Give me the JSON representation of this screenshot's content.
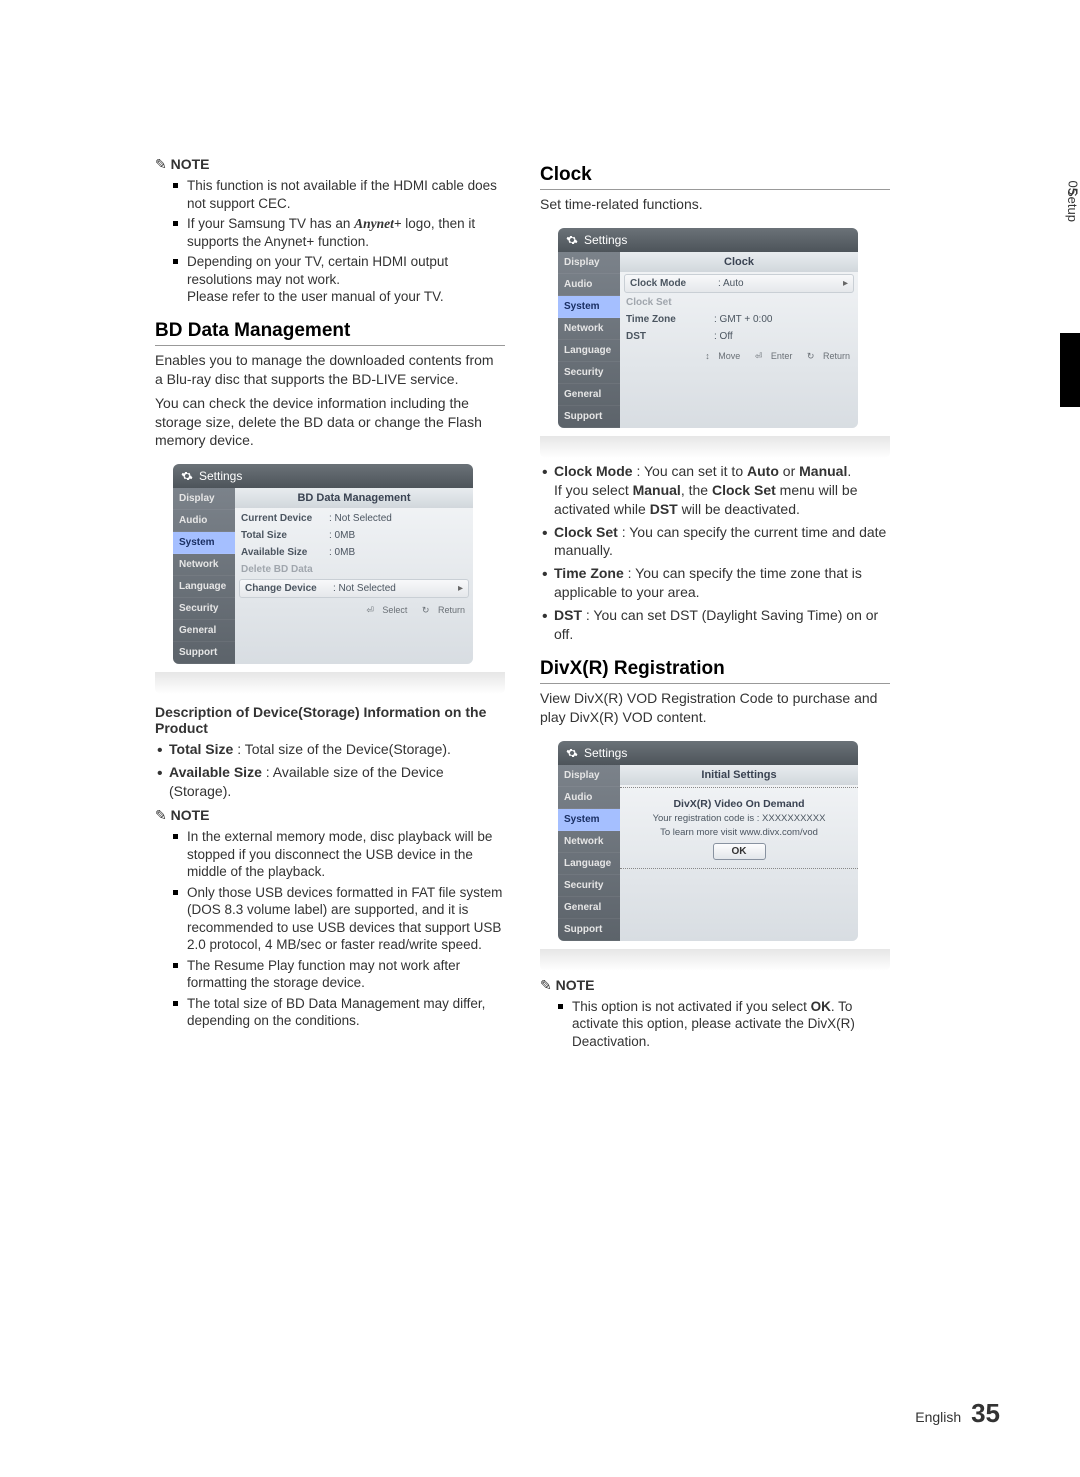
{
  "tab": {
    "num": "05",
    "label": "Setup"
  },
  "left": {
    "note1_heading": "NOTE",
    "note1_items": [
      "This function is not available if the HDMI cable does not support CEC.",
      "If your Samsung TV has an Anynet+ logo, then it supports the Anynet+ function.",
      "Depending on your TV, certain HDMI output resolutions may not work.\nPlease refer to the user manual of your TV."
    ],
    "bd_heading": "BD Data Management",
    "bd_p1": "Enables you to manage the downloaded contents from a Blu-ray disc that supports the BD-LIVE service.",
    "bd_p2": "You can check the device information including the storage size, delete the BD data or change the Flash memory device.",
    "panel1": {
      "header": "Settings",
      "nav": [
        "Display",
        "Audio",
        "System",
        "Network",
        "Language",
        "Security",
        "General",
        "Support"
      ],
      "nav_active_index": 2,
      "title": "BD Data Management",
      "rows": [
        {
          "label": "Current Device",
          "val": ": Not Selected",
          "type": "normal"
        },
        {
          "label": "Total Size",
          "val": ": 0MB",
          "type": "normal"
        },
        {
          "label": "Available Size",
          "val": ": 0MB",
          "type": "normal"
        },
        {
          "label": "Delete BD Data",
          "val": "",
          "type": "disabled"
        },
        {
          "label": "Change Device",
          "val": ": Not Selected",
          "type": "selectable"
        }
      ],
      "hints": {
        "select": "Select",
        "ret": "Return"
      }
    },
    "desc_heading": "Description of Device(Storage) Information on the Product",
    "desc_items": [
      {
        "bold": "Total Size",
        "rest": " : Total size of the Device(Storage)."
      },
      {
        "bold": "Available Size",
        "rest": " : Available size of the Device (Storage)."
      }
    ],
    "note2_heading": "NOTE",
    "note2_items": [
      "In the external memory mode, disc playback will be stopped if you disconnect the USB device in the middle of the playback.",
      "Only those USB devices formatted in FAT file system (DOS 8.3 volume label) are supported, and it is recommended to use USB devices that support USB 2.0 protocol, 4 MB/sec or faster read/write speed.",
      "The Resume Play function may not work after formatting the storage device.",
      "The total size of BD Data Management may differ, depending on the conditions."
    ]
  },
  "right": {
    "clock_heading": "Clock",
    "clock_intro": "Set time-related functions.",
    "panel2": {
      "header": "Settings",
      "nav": [
        "Display",
        "Audio",
        "System",
        "Network",
        "Language",
        "Security",
        "General",
        "Support"
      ],
      "nav_active_index": 2,
      "title": "Clock",
      "rows": [
        {
          "label": "Clock Mode",
          "val": ": Auto",
          "type": "selectable"
        },
        {
          "label": "Clock Set",
          "val": "",
          "type": "disabled"
        },
        {
          "label": "Time Zone",
          "val": ": GMT + 0:00",
          "type": "normal"
        },
        {
          "label": "DST",
          "val": ": Off",
          "type": "normal"
        }
      ],
      "hints": {
        "move": "Move",
        "enter": "Enter",
        "ret": "Return"
      }
    },
    "clock_items": [
      {
        "lead": "Clock Mode",
        "text": " : You can set it to ",
        "b2": "Auto",
        "mid": " or ",
        "b3": "Manual",
        "tail": ".",
        "extra": "If you select Manual, the Clock Set menu will be activated while DST will be deactivated.",
        "extra_bold": [
          "Manual",
          "Clock Set",
          "DST"
        ]
      },
      {
        "lead": "Clock Set",
        "text": " : You can specify the current time and date manually."
      },
      {
        "lead": "Time Zone",
        "text": " : You can specify the time zone that is applicable to your area."
      },
      {
        "lead": "DST",
        "text": " : You can set DST (Daylight Saving Time) on or off."
      }
    ],
    "divx_heading": "DivX(R) Registration",
    "divx_intro": "View DivX(R) VOD Registration Code to purchase and play DivX(R) VOD content.",
    "panel3": {
      "header": "Settings",
      "nav": [
        "Display",
        "Audio",
        "System",
        "Network",
        "Language",
        "Security",
        "General",
        "Support"
      ],
      "nav_active_index": 2,
      "title": "Initial Settings",
      "d_title": "DivX(R) Video On Demand",
      "d_line1": "Your registration code is : XXXXXXXXXX",
      "d_line2": "To learn more visit www.divx.com/vod",
      "ok": "OK"
    },
    "note3_heading": "NOTE",
    "note3_item_pre": "This option is not activated if you select ",
    "note3_item_bold": "OK",
    "note3_item_post": ". To activate this option, please activate the DivX(R) Deactivation."
  },
  "footer": {
    "lang": "English",
    "page": "35"
  }
}
